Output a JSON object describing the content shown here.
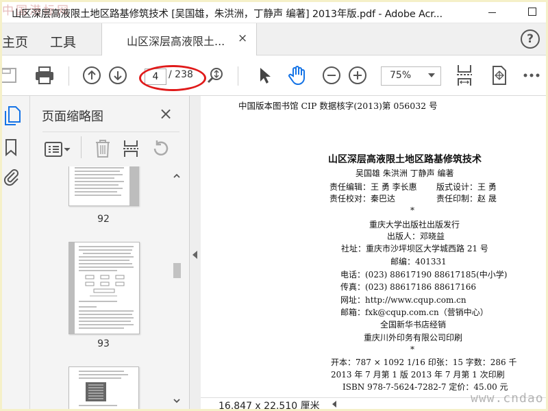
{
  "window": {
    "watermark_logo": "中国港标网",
    "title": "山区深层高液限土地区路基修筑技术 [吴国雄，朱洪洲，丁静声 编著] 2013年版.pdf - Adobe Acr..."
  },
  "menu": {
    "home": "主页",
    "tools": "工具",
    "tab_label": "山区深层高液限土...",
    "tab_close": "×",
    "help": "?"
  },
  "toolbar": {
    "page_current": "4",
    "page_total": "/ 238",
    "zoom": "75%"
  },
  "thumbnails_panel": {
    "title": "页面缩略图",
    "close": "×",
    "pages": [
      {
        "number": "92"
      },
      {
        "number": "93"
      }
    ]
  },
  "document": {
    "cip": "中国版本图书馆 CIP 数据核字(2013)第 056032 号",
    "book_title": "山区深层高液限土地区路基修筑技术",
    "authors": "吴国雄  朱洪洲  丁静声   编著",
    "editor": "责任编辑：王  勇  李长惠",
    "designer": "版式设计：王  勇",
    "proofreader": "责任校对：秦巴达",
    "printer_resp": "责任印制：赵  晟",
    "star1": "*",
    "publisher": "重庆大学出版社出版发行",
    "publisher_person": "出版人：邓晓益",
    "address": "社址：重庆市沙坪坝区大学城西路 21 号",
    "postcode": "邮编：401331",
    "phone": "电话：(023) 88617190   88617185(中小学)",
    "fax": "传真：(023) 88617186   88617166",
    "website": "网址：http://www.cqup.com.cn",
    "email": "邮箱：fxk@cqup.com.cn（营销中心）",
    "distributor": "全国新华书店经销",
    "printing_company": "重庆川外印务有限公司印刷",
    "star2": "*",
    "format": "开本：787 × 1092   1/16   印张：15   字数：286 千",
    "edition": "2013 年 7 月第 1 版      2013 年 7 月第 1 次印刷",
    "isbn": "ISBN 978-7-5624-7282-7   定价：45.00 元"
  },
  "statusbar": {
    "dimensions": "16.847 x 22.510 厘米"
  },
  "page_watermark": "www.cndao.com"
}
